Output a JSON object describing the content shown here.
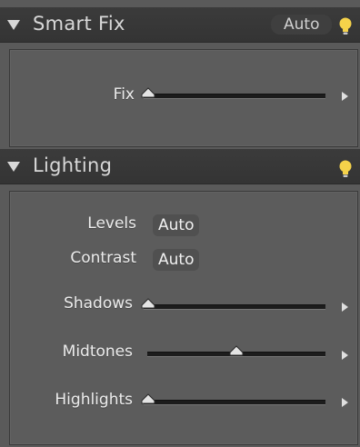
{
  "smart_fix": {
    "title": "Smart Fix",
    "auto_label": "Auto",
    "bulb_icon": "lightbulb-icon",
    "fix": {
      "label": "Fix",
      "value": 0.0
    }
  },
  "lighting": {
    "title": "Lighting",
    "bulb_icon": "lightbulb-icon",
    "levels": {
      "label": "Levels",
      "button": "Auto"
    },
    "contrast": {
      "label": "Contrast",
      "button": "Auto"
    },
    "shadows": {
      "label": "Shadows",
      "value": 0.0
    },
    "midtones": {
      "label": "Midtones",
      "value": 0.5
    },
    "highlights": {
      "label": "Highlights",
      "value": 0.0
    }
  },
  "colors": {
    "bulb": "#f5d24a",
    "accent_text": "#ececec"
  }
}
